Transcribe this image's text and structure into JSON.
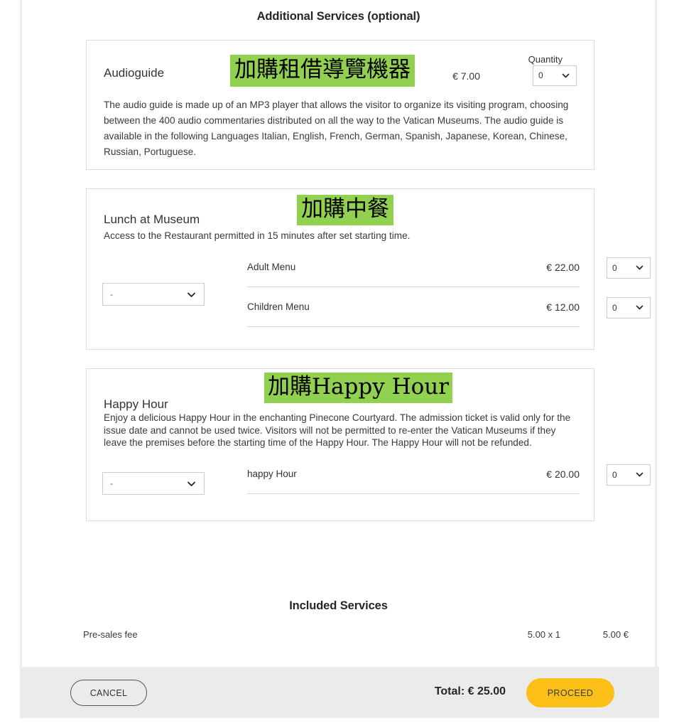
{
  "page": {
    "additional_title": "Additional Services (optional)",
    "included_title": "Included Services"
  },
  "colors": {
    "highlight_green": "#92d050",
    "proceed_yellow": "#fcbf18",
    "footer_grey": "#ebebeb",
    "card_border": "#dddddd"
  },
  "audioguide": {
    "name": "Audioguide",
    "badge": "加購租借導覽機器",
    "price": "€ 7.00",
    "quantity_label": "Quantity",
    "quantity_value": "0",
    "description": "The audio guide is made up of an MP3 player that allows the visitor to organize its visiting program, choosing between the 400 audio commentaries distributed on all the way to the Vatican Museums. The audio guide is available in the following Languages Italian, English, French, German, Spanish, Japanese, Korean, Chinese, Russian, Portuguese."
  },
  "lunch": {
    "name": "Lunch at Museum",
    "badge": "加購中餐",
    "subtitle": "Access to the Restaurant permitted in 15 minutes after set starting time.",
    "time_select_value": "-",
    "rows": [
      {
        "name": "Adult Menu",
        "price": "€ 22.00",
        "quantity": "0"
      },
      {
        "name": "Children Menu",
        "price": "€ 12.00",
        "quantity": "0"
      }
    ]
  },
  "happy_hour": {
    "name": "Happy Hour",
    "badge": "加購Happy Hour",
    "description": "Enjoy a delicious Happy Hour in the enchanting Pinecone Courtyard. The admission ticket is valid only for the issue date and cannot be used twice. Visitors will not be permitted to re-enter the Vatican Museums if they leave the premises before the starting time of the Happy Hour. The Happy Hour will not be refunded.",
    "time_select_value": "-",
    "rows": [
      {
        "name": "happy Hour",
        "price": "€ 20.00",
        "quantity": "0"
      }
    ]
  },
  "included_services": {
    "rows": [
      {
        "name": "Pre-sales fee",
        "multiplier": "5.00 x 1",
        "total": "5.00 €"
      }
    ]
  },
  "footer": {
    "cancel_label": "CANCEL",
    "total_label": "Total: € 25.00",
    "proceed_label": "PROCEED"
  }
}
